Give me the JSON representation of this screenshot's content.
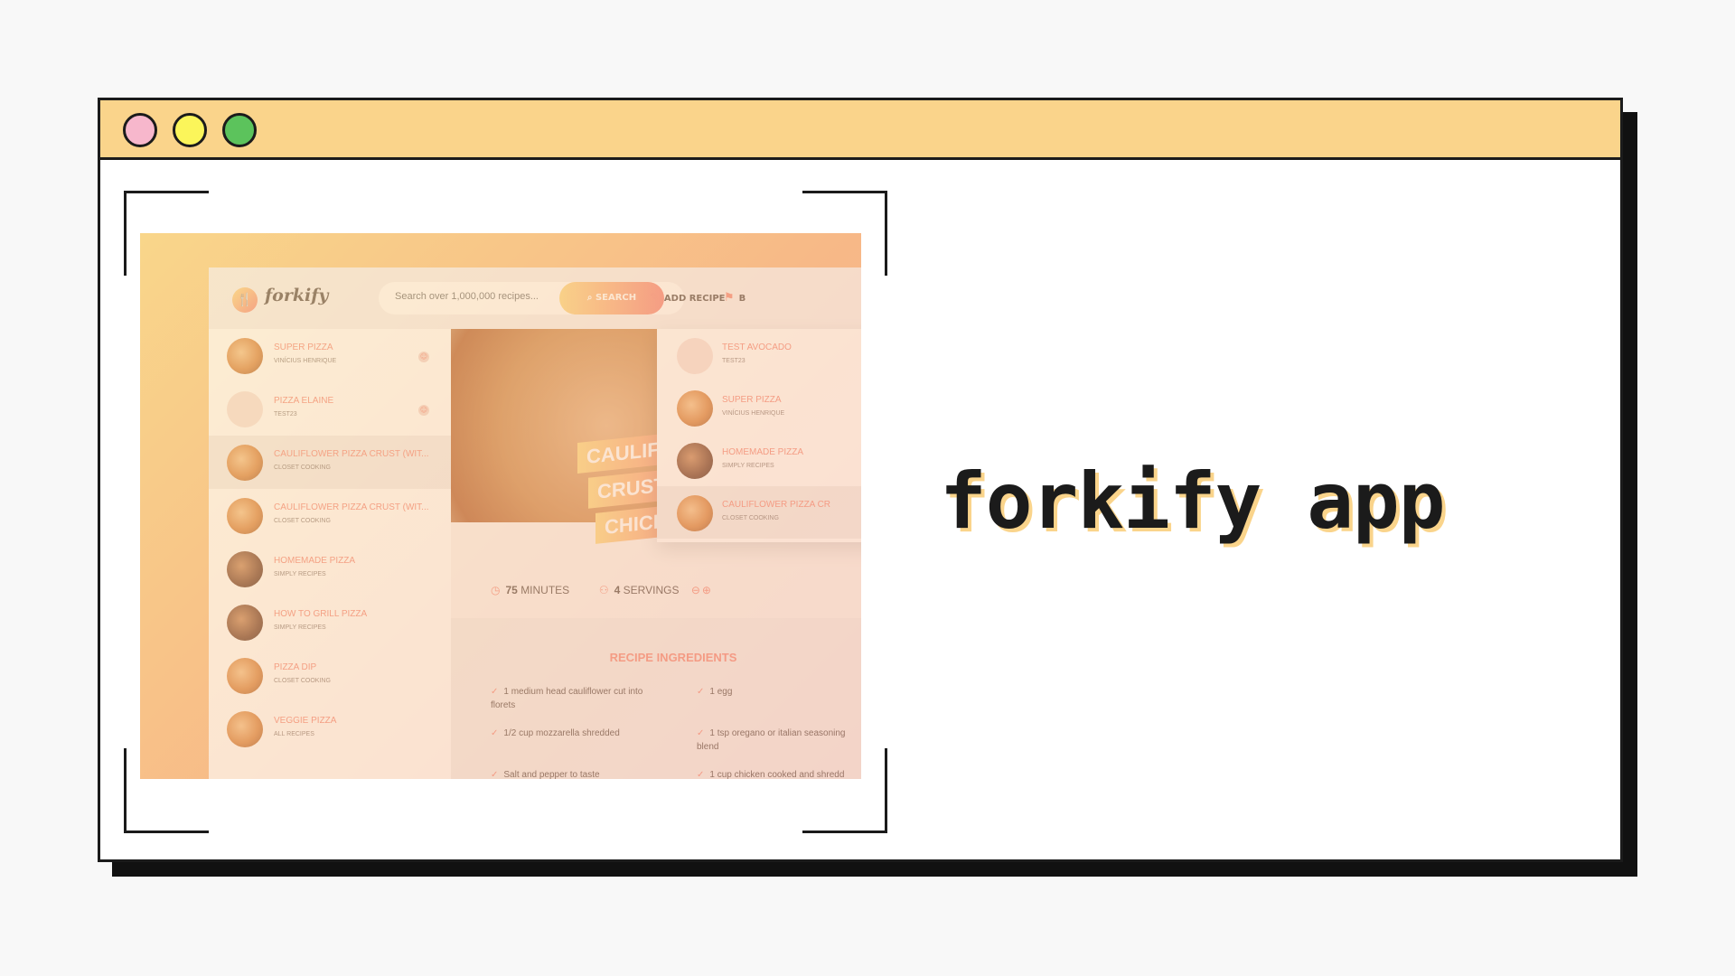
{
  "window": {
    "controls": [
      "close",
      "minimize",
      "maximize"
    ],
    "titlebar_color": "#fad48b"
  },
  "headline": "forkify app",
  "app": {
    "logo": "forkify",
    "search": {
      "placeholder": "Search over 1,000,000 recipes...",
      "button": "SEARCH"
    },
    "header_links": {
      "add_recipe": "ADD RECIPE",
      "bookmarks": "B"
    },
    "results": [
      {
        "title": "SUPER PIZZA",
        "publisher": "VINÍCIUS HENRIQUE",
        "user": true
      },
      {
        "title": "PIZZA ELAINE",
        "publisher": "TEST23",
        "user": true
      },
      {
        "title": "CAULIFLOWER PIZZA CRUST (WIT...",
        "publisher": "CLOSET COOKING",
        "active": true
      },
      {
        "title": "CAULIFLOWER PIZZA CRUST (WIT...",
        "publisher": "CLOSET COOKING"
      },
      {
        "title": "HOMEMADE PIZZA",
        "publisher": "SIMPLY RECIPES"
      },
      {
        "title": "HOW TO GRILL PIZZA",
        "publisher": "SIMPLY RECIPES"
      },
      {
        "title": "PIZZA DIP",
        "publisher": "CLOSET COOKING"
      },
      {
        "title": "VEGGIE PIZZA",
        "publisher": "ALL RECIPES"
      }
    ],
    "recipe": {
      "title_lines": [
        "CAULIFLOW",
        "CRUST (V",
        "CHICKEN"
      ],
      "cooking_time": "75",
      "cooking_unit": "MINUTES",
      "servings": "4",
      "servings_unit": "SERVINGS",
      "ingredients_title": "RECIPE INGREDIENTS",
      "ingredients": [
        "1 medium head cauliflower cut into florets",
        "1 egg",
        "1/2 cup mozzarella shredded",
        "1 tsp oregano or italian seasoning blend",
        "Salt and pepper to taste",
        "1 cup chicken cooked and shredd"
      ]
    },
    "bookmarks_dropdown": [
      {
        "title": "TEST AVOCADO",
        "publisher": "TEST23"
      },
      {
        "title": "SUPER PIZZA",
        "publisher": "VINÍCIUS HENRIQUE"
      },
      {
        "title": "HOMEMADE PIZZA",
        "publisher": "SIMPLY RECIPES"
      },
      {
        "title": "CAULIFLOWER PIZZA CR",
        "publisher": "CLOSET COOKING",
        "active": true
      }
    ]
  }
}
